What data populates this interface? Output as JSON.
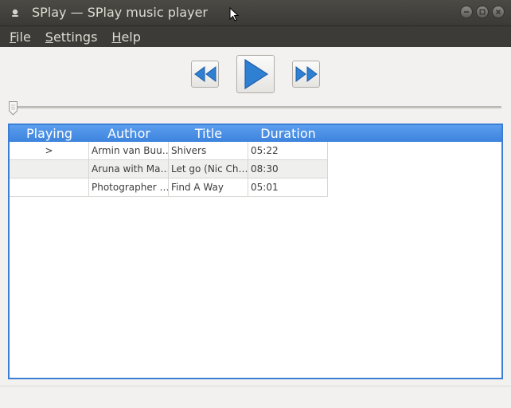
{
  "window": {
    "title": "SPlay — SPlay music player"
  },
  "menu": {
    "file": {
      "underline": "F",
      "rest": "ile"
    },
    "settings": {
      "underline": "S",
      "rest": "ettings"
    },
    "help": {
      "underline": "H",
      "rest": "elp"
    }
  },
  "controls": {
    "rewind_icon": "rewind-icon",
    "play_icon": "play-icon",
    "forward_icon": "fast-forward-icon",
    "accent": "#2f7fd2"
  },
  "seek": {
    "position_fraction": 0.0
  },
  "playlist": {
    "columns": [
      "Playing",
      "Author",
      "Title",
      "Duration"
    ],
    "rows": [
      {
        "playing": ">",
        "author": "Armin van Buu…",
        "title": "Shivers",
        "duration": "05:22"
      },
      {
        "playing": "",
        "author": "Aruna with Ma…",
        "title": "Let go (Nic Ch…",
        "duration": "08:30"
      },
      {
        "playing": "",
        "author": "Photographer …",
        "title": "Find A Way",
        "duration": "05:01"
      }
    ],
    "header_color": "#4a90e2"
  }
}
